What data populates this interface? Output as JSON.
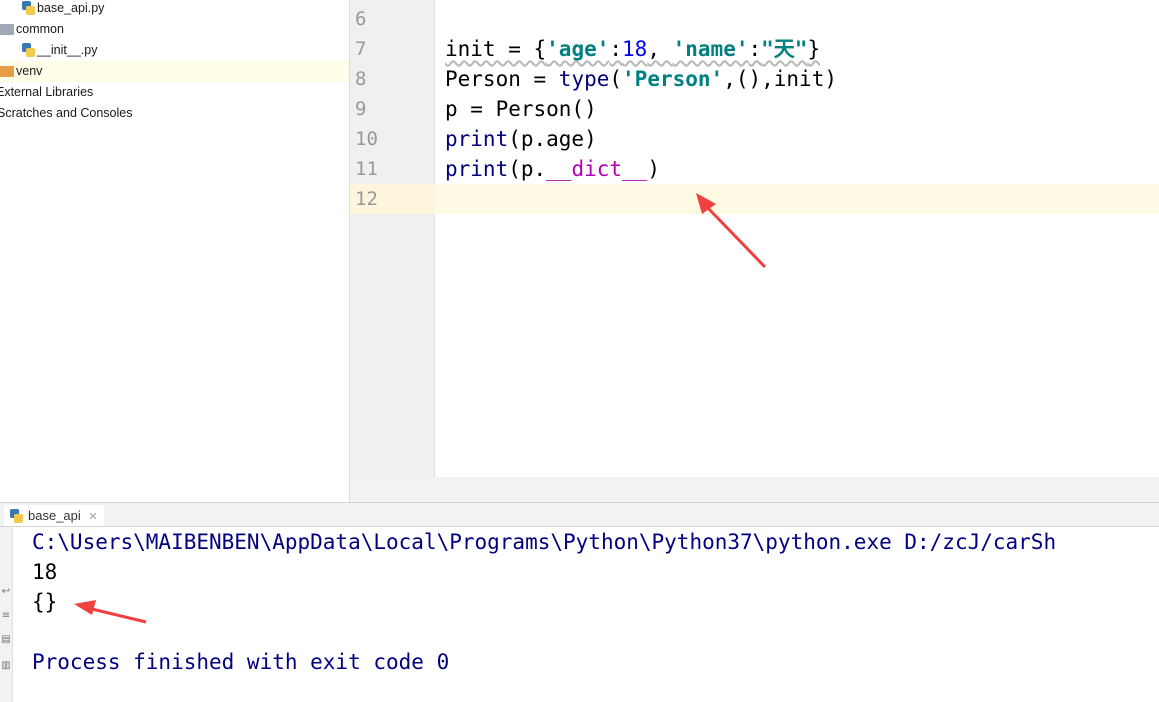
{
  "project_tree": {
    "items": [
      {
        "label": "base_api.py",
        "icon": "python-file-icon"
      },
      {
        "label": "common",
        "icon": "folder-icon"
      },
      {
        "label": "__init__.py",
        "icon": "python-file-icon"
      },
      {
        "label": "venv",
        "icon": "folder-icon"
      },
      {
        "label": "External Libraries",
        "icon": ""
      },
      {
        "label": "Scratches and Consoles",
        "icon": ""
      }
    ]
  },
  "editor": {
    "line_numbers": [
      "6",
      "7",
      "8",
      "9",
      "10",
      "11",
      "12"
    ],
    "lines": {
      "l7": {
        "a": "init = {",
        "b": "'age'",
        "c": ":",
        "d": "18",
        "e": ", ",
        "f": "'name'",
        "g": ":",
        "h": "\"天\"",
        "i": "}"
      },
      "l8": {
        "a": "Person = ",
        "b": "type",
        "c": "(",
        "d": "'Person'",
        "e": ",(),init)"
      },
      "l9": {
        "a": "p = Person()"
      },
      "l10": {
        "a": "print",
        "b": "(p.age)"
      },
      "l11": {
        "a": "print",
        "b": "(p.",
        "c": "__dict__",
        "d": ")"
      }
    }
  },
  "run_panel": {
    "tab_label": "base_api",
    "output": [
      "C:\\Users\\MAIBENBEN\\AppData\\Local\\Programs\\Python\\Python37\\python.exe D:/zcJ/carSh",
      "18",
      "{}",
      "",
      "Process finished with exit code 0"
    ]
  },
  "colors": {
    "string": "#008080",
    "number": "#0000ff",
    "builtin": "#000080",
    "magic": "#b200b2",
    "annotation_arrow": "#f04040",
    "caret_line": "#fffae3"
  }
}
